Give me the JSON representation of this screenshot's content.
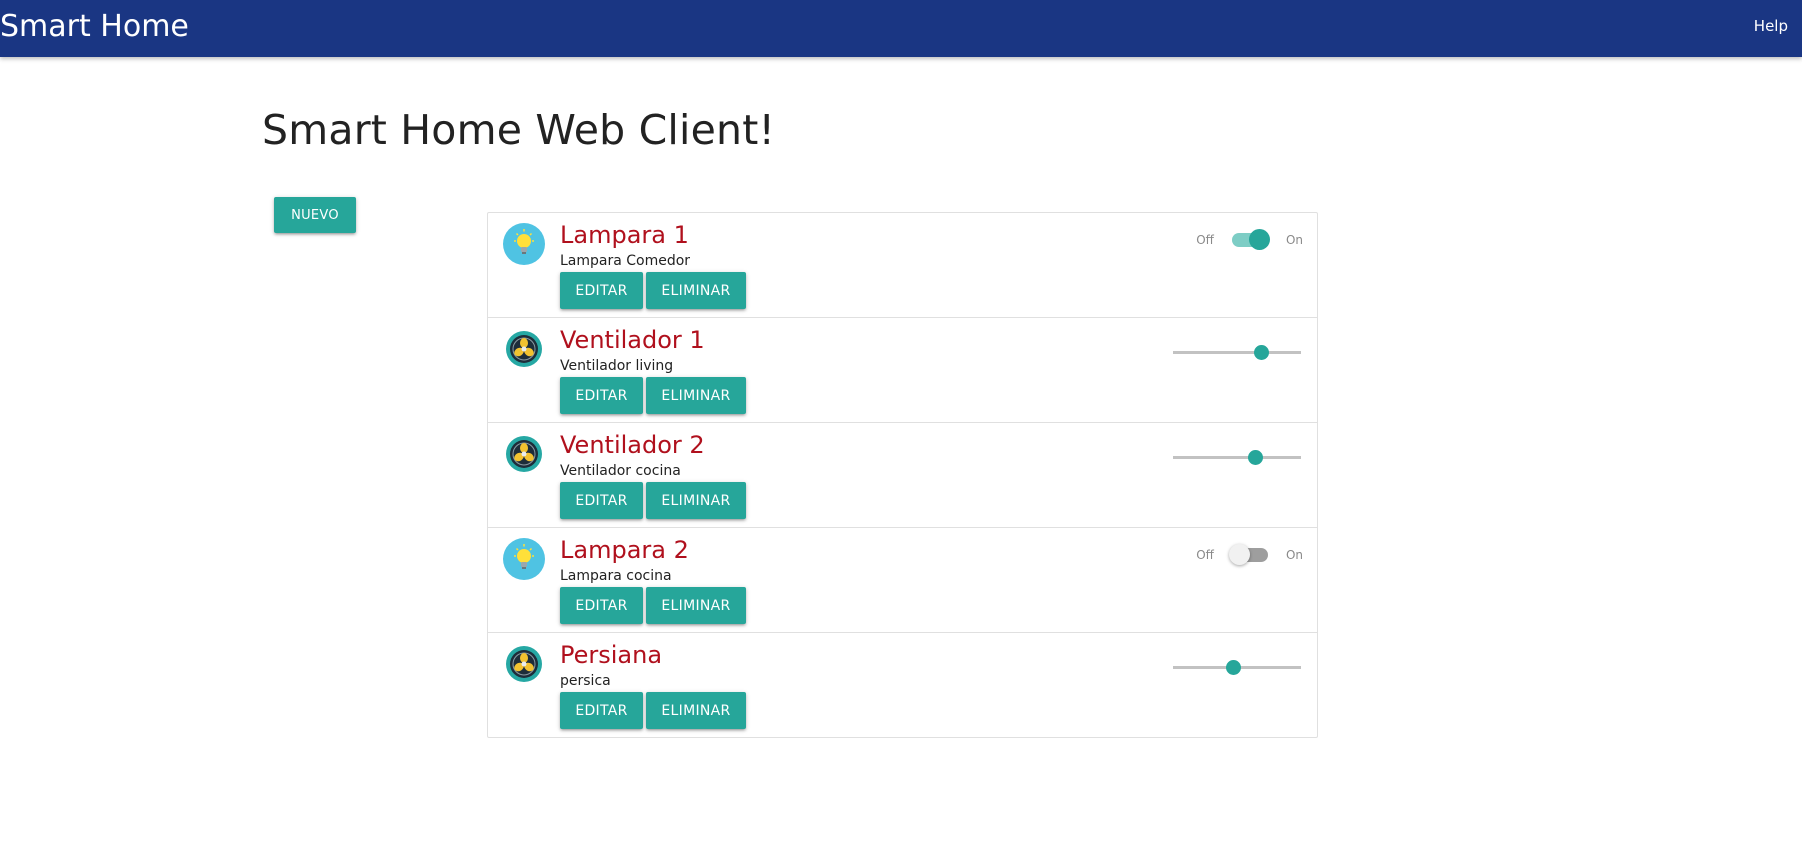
{
  "navbar": {
    "brand": "Smart Home",
    "help_label": "Help",
    "color": "#1a3683"
  },
  "page": {
    "title": "Smart Home Web Client!",
    "new_button_label": "NUEVO"
  },
  "colors": {
    "accent": "#26a69a",
    "device_title": "#b0101d"
  },
  "devices": [
    {
      "name": "Lampara 1",
      "description": "Lampara Comedor",
      "icon": "lightbulb-icon",
      "control": "switch",
      "state": "on",
      "off_label": "Off",
      "on_label": "On",
      "edit_label": "EDITAR",
      "delete_label": "ELIMINAR"
    },
    {
      "name": "Ventilador 1",
      "description": "Ventilador living",
      "icon": "fan-icon",
      "control": "slider",
      "level": 0.69,
      "edit_label": "EDITAR",
      "delete_label": "ELIMINAR"
    },
    {
      "name": "Ventilador 2",
      "description": "Ventilador cocina",
      "icon": "fan-icon",
      "control": "slider",
      "level": 0.64,
      "edit_label": "EDITAR",
      "delete_label": "ELIMINAR"
    },
    {
      "name": "Lampara 2",
      "description": "Lampara cocina",
      "icon": "lightbulb-icon",
      "control": "switch",
      "state": "off",
      "off_label": "Off",
      "on_label": "On",
      "edit_label": "EDITAR",
      "delete_label": "ELIMINAR"
    },
    {
      "name": "Persiana",
      "description": "persica",
      "icon": "fan-icon",
      "control": "slider",
      "level": 0.47,
      "edit_label": "EDITAR",
      "delete_label": "ELIMINAR"
    }
  ]
}
